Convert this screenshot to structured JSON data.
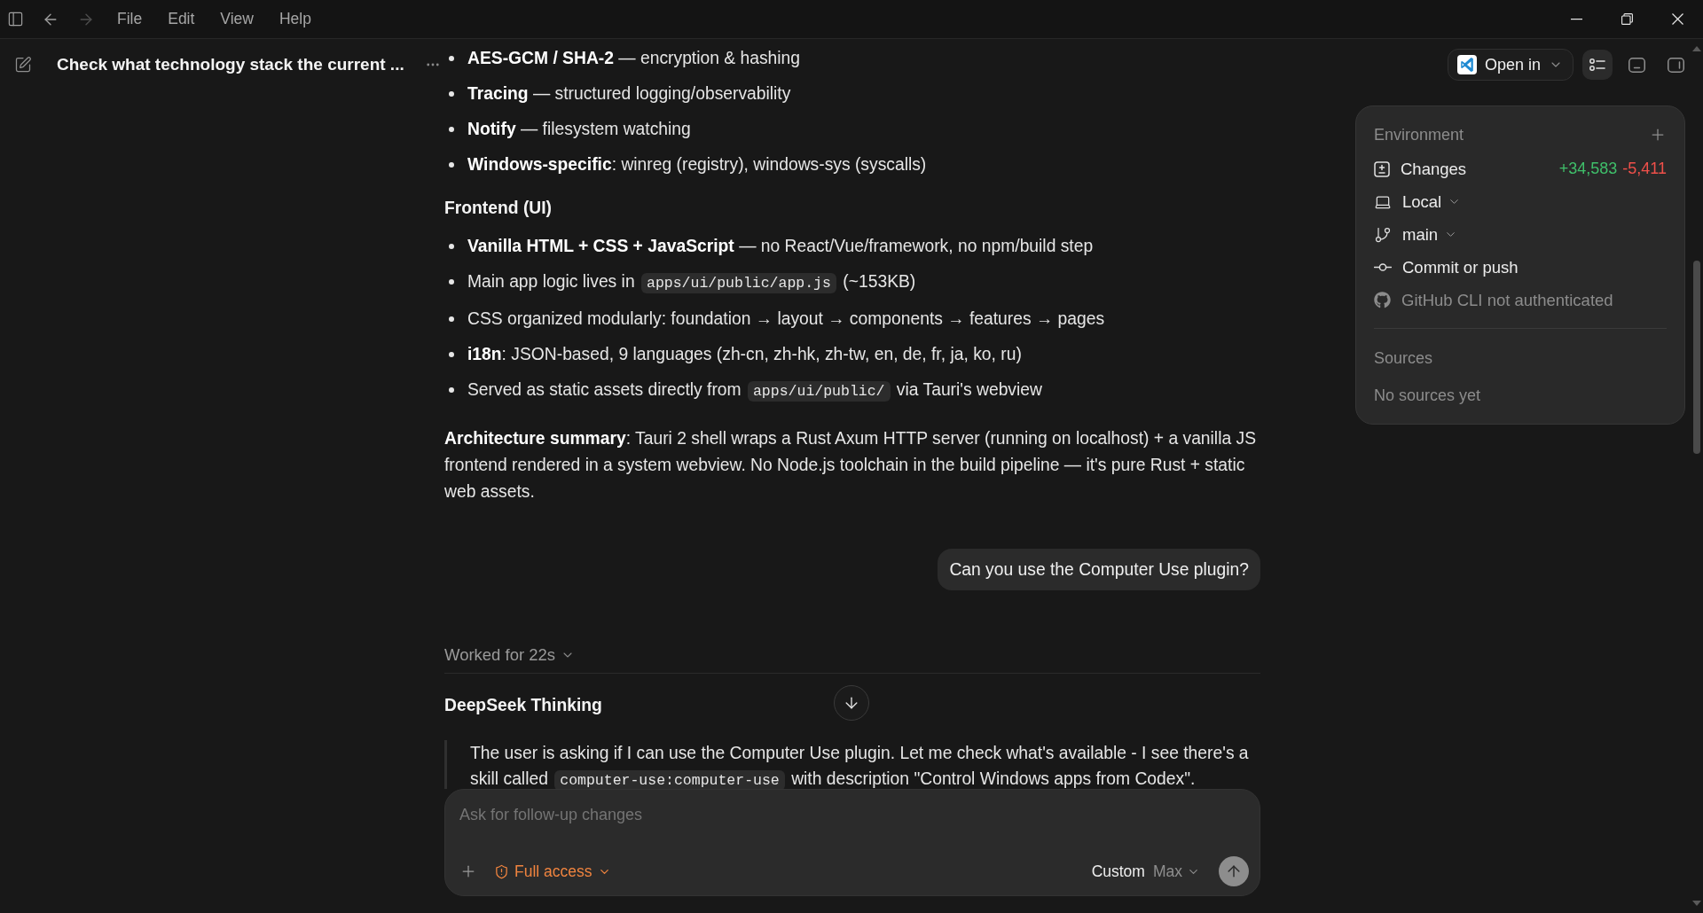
{
  "titlebar": {
    "nav": [
      {
        "kind": "back",
        "disabled": false
      },
      {
        "kind": "forward",
        "disabled": true
      }
    ],
    "menus": [
      "File",
      "Edit",
      "View",
      "Help"
    ]
  },
  "thread_header": {
    "title": "Check what technology stack the current ..."
  },
  "toolbar": {
    "open_in": "Open in",
    "toggles": [
      {
        "kind": "tasks",
        "selected": true
      },
      {
        "kind": "bottom_panel",
        "selected": false
      },
      {
        "kind": "side_panel",
        "selected": false
      }
    ]
  },
  "thread": [
    {
      "kind": "bullets",
      "items": [
        {
          "segments": [
            {
              "kind": "text",
              "text": "**AES-GCM / SHA-2** — encryption & hashing"
            }
          ]
        },
        {
          "segments": [
            {
              "kind": "text",
              "text": "**Tracing** — structured logging/observability"
            }
          ]
        },
        {
          "segments": [
            {
              "kind": "text",
              "text": "**Notify** — filesystem watching"
            }
          ]
        },
        {
          "segments": [
            {
              "kind": "text",
              "text": "**Windows-specific**: winreg (registry), windows-sys (syscalls)"
            }
          ]
        }
      ]
    },
    {
      "kind": "heading",
      "text": "Frontend (UI)"
    },
    {
      "kind": "bullets",
      "items": [
        {
          "segments": [
            {
              "kind": "text",
              "text": "**Vanilla HTML + CSS + JavaScript** — no React/Vue/framework, no npm/build step"
            }
          ]
        },
        {
          "segments": [
            {
              "kind": "text",
              "text": "Main app logic lives in "
            },
            {
              "kind": "code",
              "text": "apps/ui/public/app.js"
            },
            {
              "kind": "text",
              "text": " (~153KB)"
            }
          ]
        },
        {
          "segments": [
            {
              "kind": "text",
              "text": "CSS organized modularly: foundation → layout → components → features → pages"
            }
          ]
        },
        {
          "segments": [
            {
              "kind": "text",
              "text": "**i18n**: JSON-based, 9 languages (zh-cn, zh-hk, zh-tw, en, de, fr, ja, ko, ru)"
            }
          ]
        },
        {
          "segments": [
            {
              "kind": "text",
              "text": "Served as static assets directly from "
            },
            {
              "kind": "code",
              "text": "apps/ui/public/"
            },
            {
              "kind": "text",
              "text": " via Tauri's webview"
            }
          ]
        }
      ]
    },
    {
      "kind": "paragraph",
      "segments": [
        {
          "kind": "text",
          "text": "**Architecture summary**: Tauri 2 shell wraps a Rust Axum HTTP server (running on localhost) + a vanilla JS frontend rendered in a system webview. No Node.js toolchain in the build pipeline — it's pure Rust + static web assets."
        }
      ]
    },
    {
      "kind": "user_message",
      "text": "Can you use the Computer Use plugin?"
    },
    {
      "kind": "worked",
      "text": "Worked for 22s",
      "expanded": false
    },
    {
      "kind": "reasoning_title",
      "text": "DeepSeek Thinking"
    },
    {
      "kind": "reasoning",
      "segments": [
        {
          "kind": "text",
          "text": "The user is asking if I can use the Computer Use plugin. Let me check what's available - I see there's a skill called "
        },
        {
          "kind": "code",
          "text": "computer-use:computer-use"
        },
        {
          "kind": "text",
          "text": " with description \"Control Windows apps from Codex\"."
        }
      ]
    }
  ],
  "composer": {
    "placeholder": "Ask for follow-up changes",
    "access": "Full access",
    "model": "Custom",
    "effort": "Max"
  },
  "environment": {
    "title": "Environment",
    "rows": [
      {
        "kind": "changes",
        "label": "Changes",
        "added": "+34,583",
        "removed": "-5,411",
        "dropdown": false,
        "disabled": false
      },
      {
        "kind": "local",
        "label": "Local",
        "dropdown": true,
        "disabled": false
      },
      {
        "kind": "branch",
        "label": "main",
        "dropdown": true,
        "disabled": false
      },
      {
        "kind": "commit",
        "label": "Commit or push",
        "dropdown": false,
        "disabled": false
      },
      {
        "kind": "github",
        "label": "GitHub CLI not authenticated",
        "dropdown": false,
        "disabled": true
      }
    ],
    "sources": {
      "title": "Sources",
      "empty": "No sources yet"
    }
  }
}
